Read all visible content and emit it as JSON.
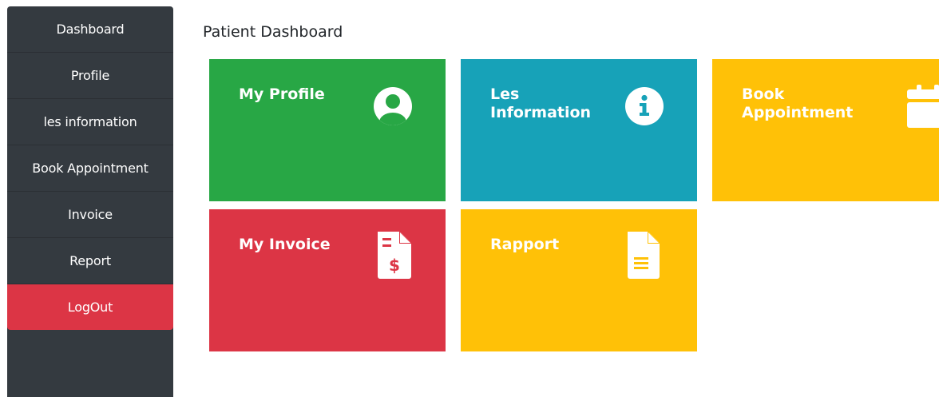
{
  "sidebar": {
    "items": [
      {
        "label": "Dashboard"
      },
      {
        "label": "Profile"
      },
      {
        "label": "les information"
      },
      {
        "label": "Book Appointment"
      },
      {
        "label": "Invoice"
      },
      {
        "label": "Report"
      }
    ],
    "logout": {
      "label": "LogOut",
      "color": "#dc3545"
    }
  },
  "main": {
    "title": "Patient Dashboard",
    "cards": [
      {
        "title": "My Profile",
        "icon": "user-circle-icon",
        "color": "#28a745"
      },
      {
        "title": "Les Information",
        "icon": "info-circle-icon",
        "color": "#17a2b8"
      },
      {
        "title": "Book Appointment",
        "icon": "calendar-icon",
        "color": "#ffc107"
      },
      {
        "title": "My Invoice",
        "icon": "invoice-dollar-icon",
        "color": "#dc3545"
      },
      {
        "title": "Rapport",
        "icon": "file-text-icon",
        "color": "#ffc107"
      }
    ]
  }
}
